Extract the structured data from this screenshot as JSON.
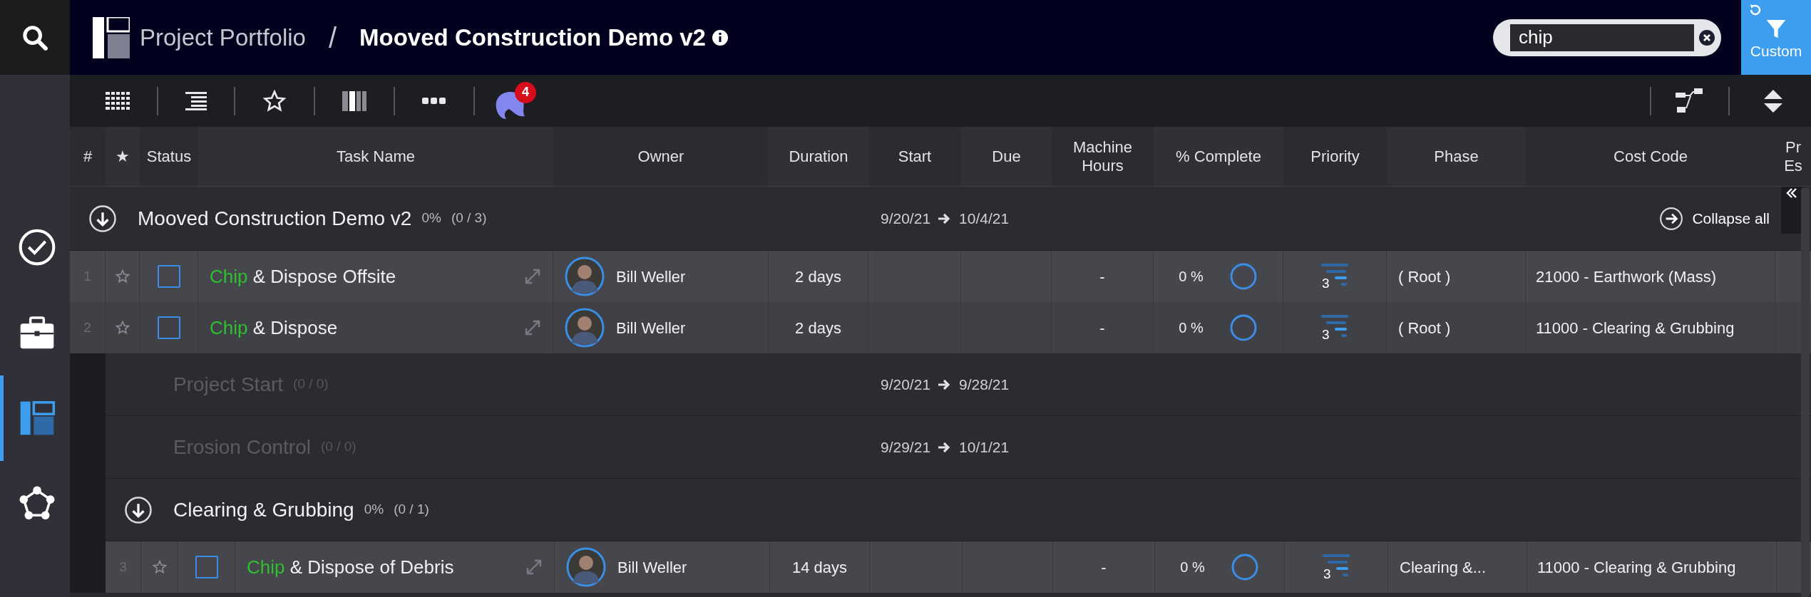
{
  "header": {
    "breadcrumb_parent": "Project Portfolio",
    "separator": "/",
    "title": "Mooved Construction Demo v2"
  },
  "search": {
    "value": "chip"
  },
  "filter_button": {
    "label": "Custom"
  },
  "toolbar": {
    "notification_count": "4"
  },
  "sidebar": {
    "items": [
      {
        "kind": "check",
        "selected": false
      },
      {
        "kind": "briefcase",
        "selected": false
      },
      {
        "kind": "layout",
        "selected": true
      },
      {
        "kind": "network",
        "selected": false
      }
    ]
  },
  "table": {
    "columns": [
      "#",
      "★",
      "Status",
      "Task Name",
      "Owner",
      "Duration",
      "Start",
      "Due",
      "Machine Hours",
      "% Complete",
      "Priority",
      "Phase",
      "Cost Code",
      "Pr Es"
    ],
    "groups": [
      {
        "name": "Mooved Construction Demo v2",
        "percent": "0%",
        "count": "(0 / 3)",
        "start": "9/20/21",
        "due": "10/4/21",
        "expanded": true,
        "dimmed": false,
        "action": "Collapse all",
        "children": [
          {
            "kind": "task",
            "number": "1",
            "starred": false,
            "checked": false,
            "match": "Chip",
            "rest": " & Dispose Offsite",
            "owner": "Bill Weller",
            "duration": "2 days",
            "machine_hours": "-",
            "complete": "0 %",
            "priority": "3",
            "phase": "( Root )",
            "cost_code": "21000 - Earthwork (Mass)"
          },
          {
            "kind": "task",
            "number": "2",
            "starred": false,
            "checked": false,
            "match": "Chip",
            "rest": " & Dispose",
            "owner": "Bill Weller",
            "duration": "2 days",
            "machine_hours": "-",
            "complete": "0 %",
            "priority": "3",
            "phase": "( Root )",
            "cost_code": "11000 - Clearing & Grubbing"
          },
          {
            "kind": "group",
            "name": "Project Start",
            "count": "(0 / 0)",
            "start": "9/20/21",
            "due": "9/28/21",
            "dimmed": true
          },
          {
            "kind": "group",
            "name": "Erosion Control",
            "count": "(0 / 0)",
            "start": "9/29/21",
            "due": "10/1/21",
            "dimmed": true
          },
          {
            "kind": "group",
            "name": "Clearing & Grubbing",
            "percent": "0%",
            "count": "(0 / 1)",
            "expanded": true,
            "dimmed": false,
            "children": [
              {
                "kind": "task",
                "number": "3",
                "starred": false,
                "checked": false,
                "match": "Chip",
                "rest": " & Dispose of Debris",
                "owner": "Bill Weller",
                "duration": "14 days",
                "machine_hours": "-",
                "complete": "0 %",
                "priority": "3",
                "phase": "Clearing &...",
                "cost_code": "11000 - Clearing & Grubbing"
              }
            ]
          }
        ]
      }
    ]
  }
}
